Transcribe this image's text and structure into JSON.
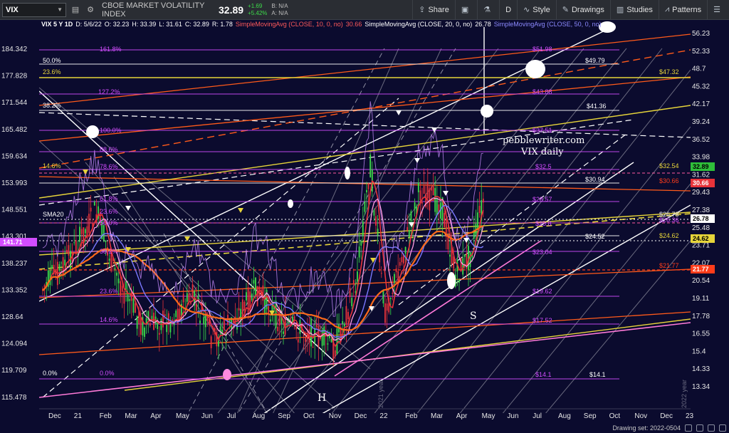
{
  "toolbar": {
    "symbol": "VIX",
    "instrument_name": "CBOE MARKET VOLATILITY INDEX",
    "last_price": "32.89",
    "change": "+1.69",
    "change_pct": "+5.42%",
    "bid": "B: N/A",
    "ask": "A: N/A",
    "share_label": "Share",
    "time_frame": "D",
    "style_label": "Style",
    "drawings_label": "Drawings",
    "studies_label": "Studies",
    "patterns_label": "Patterns"
  },
  "study_bar": {
    "symbol_period": "VIX 5 Y 1D",
    "date": "D: 5/6/22",
    "open": "O: 32.23",
    "high": "H: 33.39",
    "low": "L: 31.61",
    "close": "C: 32.89",
    "range": "R: 1.78",
    "sma10_label": "SimpleMovingAvg (CLOSE, 10, 0, no)",
    "sma10_value": "30.66",
    "sma20_label": "SimpleMovingAvg (CLOSE, 20, 0, no)",
    "sma20_value": "26.78",
    "sma50_label": "SimpleMovingAvg (CLOSE, 50, 0, no)"
  },
  "colors": {
    "background": "#0b0b2e",
    "sma10": "#e8333a",
    "sma20": "#ffffff",
    "sma50": "#7a78ff",
    "up_candle": "#3ddc4a",
    "down_candle": "#e8333a",
    "fib": "#d24dff",
    "yellow_line": "#e6d43a",
    "orange_line": "#ff6a1a"
  },
  "left_axis": [
    "184.342",
    "177.828",
    "171.544",
    "165.482",
    "159.634",
    "153.993",
    "148.551",
    "143.301",
    "138.237",
    "133.352",
    "128.64",
    "124.094",
    "119.709",
    "115.478"
  ],
  "left_axis_tag": "141.71",
  "right_axis": [
    "56.23",
    "52.33",
    "48.7",
    "45.32",
    "42.17",
    "39.24",
    "36.52",
    "33.98",
    "31.62",
    "29.43",
    "27.38",
    "25.48",
    "23.71",
    "22.07",
    "20.54",
    "19.11",
    "17.78",
    "16.55",
    "15.4",
    "14.33",
    "13.34"
  ],
  "right_axis_tags": [
    {
      "text": "32.89",
      "bg": "#2fbf3a",
      "fg": "#000000"
    },
    {
      "text": "30.66",
      "bg": "#e8333a",
      "fg": "#ffffff"
    },
    {
      "text": "26.78",
      "bg": "#ffffff",
      "fg": "#000000"
    },
    {
      "text": "24.62",
      "bg": "#e6d43a",
      "fg": "#000000"
    },
    {
      "text": "21.77",
      "bg": "#ff3c1a",
      "fg": "#ffffff"
    }
  ],
  "x_axis": [
    "Dec",
    "21",
    "Feb",
    "Mar",
    "Apr",
    "May",
    "Jun",
    "Jul",
    "Aug",
    "Sep",
    "Oct",
    "Nov",
    "Dec",
    "22",
    "Feb",
    "Mar",
    "Apr",
    "May",
    "Jun",
    "Jul",
    "Aug",
    "Sep",
    "Oct",
    "Nov",
    "Dec",
    "23"
  ],
  "year_markers": [
    "2021 year",
    "2022 year"
  ],
  "fib_left": [
    "161.8%",
    "50.0%",
    "23.6%",
    "127.2%",
    "38.2%",
    "100.0%",
    "88.6%",
    "14.6%",
    "78.6%",
    "23.6%",
    "61.8%",
    "50.0%",
    "38.2%",
    "23.6%",
    "14.6%",
    "0.0%",
    "0.0%"
  ],
  "fib_right": [
    "$51.98",
    "$49.79",
    "$47.32",
    "$43.88",
    "$41.36",
    "$37.51",
    "$32.54",
    "$32.5",
    "$30.94",
    "$30.66",
    "$28.57",
    "$26.78",
    "$26.36",
    "$25.8",
    "$24.52",
    "$24.62",
    "$23.04",
    "$21.77",
    "$19.62",
    "$17.52",
    "$14.1",
    "$14.1"
  ],
  "annotations": {
    "watermark_site": "pebblewriter.com",
    "watermark_title": "VIX daily",
    "head_letter": "H",
    "shoulder_letter": "S",
    "sma_tag": "SMA20",
    "drawing_set": "Drawing set: 2022-0504"
  }
}
